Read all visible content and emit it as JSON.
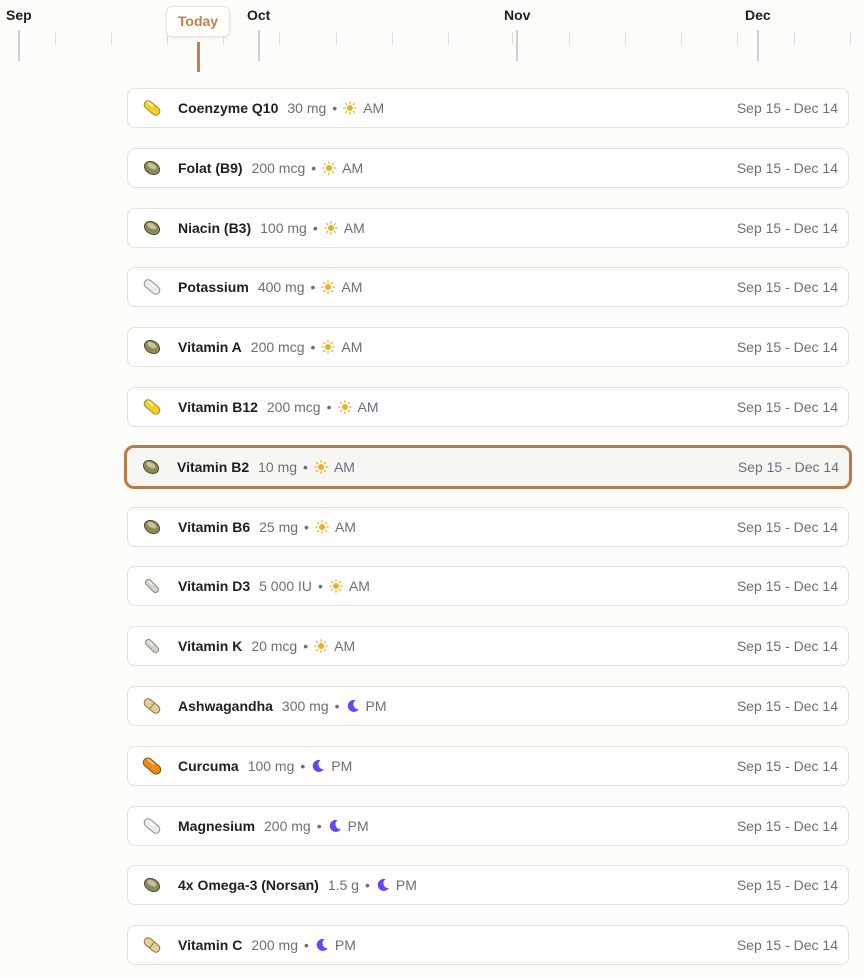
{
  "timeline": {
    "months": [
      "Sep",
      "Oct",
      "Nov",
      "Dec"
    ],
    "today_label": "Today"
  },
  "supplements": [
    {
      "name": "Coenzyme Q10",
      "dose": "30 mg",
      "time": "AM",
      "period": "am",
      "range": "Sep 15 - Dec 14",
      "pill": "yellow-pill-icon"
    },
    {
      "name": "Folat (B9)",
      "dose": "200 mcg",
      "time": "AM",
      "period": "am",
      "range": "Sep 15 - Dec 14",
      "pill": "olive-tablet-icon"
    },
    {
      "name": "Niacin (B3)",
      "dose": "100 mg",
      "time": "AM",
      "period": "am",
      "range": "Sep 15 - Dec 14",
      "pill": "olive-tablet-icon"
    },
    {
      "name": "Potassium",
      "dose": "400 mg",
      "time": "AM",
      "period": "am",
      "range": "Sep 15 - Dec 14",
      "pill": "white-capsule-icon"
    },
    {
      "name": "Vitamin A",
      "dose": "200 mcg",
      "time": "AM",
      "period": "am",
      "range": "Sep 15 - Dec 14",
      "pill": "olive-tablet-icon"
    },
    {
      "name": "Vitamin B12",
      "dose": "200 mcg",
      "time": "AM",
      "period": "am",
      "range": "Sep 15 - Dec 14",
      "pill": "yellow-pill-icon"
    },
    {
      "name": "Vitamin B2",
      "dose": "10 mg",
      "time": "AM",
      "period": "am",
      "range": "Sep 15 - Dec 14",
      "pill": "olive-tablet-icon",
      "selected": true
    },
    {
      "name": "Vitamin B6",
      "dose": "25 mg",
      "time": "AM",
      "period": "am",
      "range": "Sep 15 - Dec 14",
      "pill": "olive-tablet-icon"
    },
    {
      "name": "Vitamin D3",
      "dose": "5 000 IU",
      "time": "AM",
      "period": "am",
      "range": "Sep 15 - Dec 14",
      "pill": "grey-capsule-icon"
    },
    {
      "name": "Vitamin K",
      "dose": "20 mcg",
      "time": "AM",
      "period": "am",
      "range": "Sep 15 - Dec 14",
      "pill": "grey-capsule-icon"
    },
    {
      "name": "Ashwagandha",
      "dose": "300 mg",
      "time": "PM",
      "period": "pm",
      "range": "Sep 15 - Dec 14",
      "pill": "tan-capsule-icon"
    },
    {
      "name": "Curcuma",
      "dose": "100 mg",
      "time": "PM",
      "period": "pm",
      "range": "Sep 15 - Dec 14",
      "pill": "orange-capsule-icon"
    },
    {
      "name": "Magnesium",
      "dose": "200 mg",
      "time": "PM",
      "period": "pm",
      "range": "Sep 15 - Dec 14",
      "pill": "white-capsule-icon"
    },
    {
      "name": "4x Omega-3 (Norsan)",
      "dose": "1.5 g",
      "time": "PM",
      "period": "pm",
      "range": "Sep 15 - Dec 14",
      "pill": "olive-tablet-icon"
    },
    {
      "name": "Vitamin C",
      "dose": "200 mg",
      "time": "PM",
      "period": "pm",
      "range": "Sep 15 - Dec 14",
      "pill": "tan-capsule-icon"
    }
  ],
  "colors": {
    "accent": "#c08050",
    "sun": "#e8b12a",
    "moon": "#5b4ef0",
    "selected_border": "#b87a4b"
  }
}
